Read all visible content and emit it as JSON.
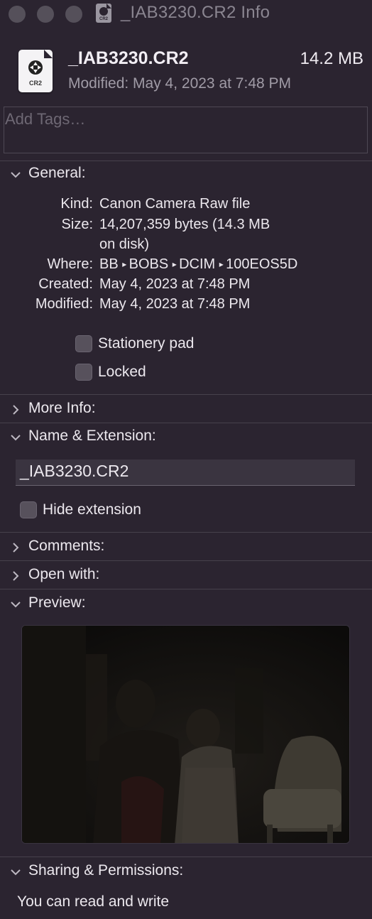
{
  "window": {
    "title": "_IAB3230.CR2 Info"
  },
  "file": {
    "name": "_IAB3230.CR2",
    "size": "14.2 MB",
    "modified": "Modified: May 4, 2023 at 7:48 PM",
    "icon_ext": "CR2",
    "icon": "cr2-file-icon"
  },
  "tags": {
    "placeholder": "Add Tags…"
  },
  "general": {
    "label": "General:",
    "kind_label": "Kind:",
    "kind_value": "Canon Camera Raw file",
    "size_label": "Size:",
    "size_value_line1": "14,207,359 bytes (14.3 MB",
    "size_value_line2": "on disk)",
    "where_label": "Where:",
    "where_path": [
      "BB",
      "BOBS",
      "DCIM",
      "100EOS5D"
    ],
    "created_label": "Created:",
    "created_value": "May 4, 2023 at 7:48 PM",
    "modified_label": "Modified:",
    "modified_value": "May 4, 2023 at 7:48 PM",
    "stationery_label": "Stationery pad",
    "stationery_checked": false,
    "locked_label": "Locked",
    "locked_checked": false
  },
  "more_info": {
    "label": "More Info:"
  },
  "name_ext": {
    "label": "Name & Extension:",
    "value": "_IAB3230.CR2",
    "hide_ext_label": "Hide extension",
    "hide_ext_checked": false
  },
  "comments": {
    "label": "Comments:"
  },
  "open_with": {
    "label": "Open with:"
  },
  "preview": {
    "label": "Preview:"
  },
  "sharing": {
    "label": "Sharing & Permissions:",
    "text": "You can read and write"
  }
}
